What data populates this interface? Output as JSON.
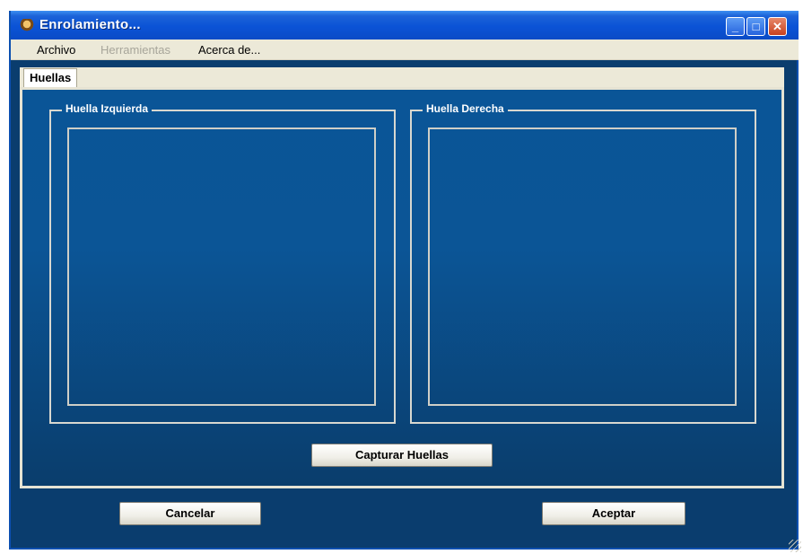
{
  "window": {
    "title": "Enrolamiento...",
    "icon": "app-icon",
    "controls": {
      "minimize": "_",
      "maximize": "□",
      "close": "✕"
    }
  },
  "menu": [
    {
      "label": "Archivo",
      "enabled": true
    },
    {
      "label": "Herramientas",
      "enabled": false
    },
    {
      "label": "Acerca de...",
      "enabled": true
    }
  ],
  "tabs": [
    {
      "label": "Huellas",
      "selected": true
    }
  ],
  "groups": {
    "left": {
      "label": "Huella Izquierda"
    },
    "right": {
      "label": "Huella Derecha"
    }
  },
  "buttons": {
    "capture": "Capturar Huellas",
    "cancel": "Cancelar",
    "accept": "Aceptar"
  },
  "colors": {
    "panel_top": "#0a5597",
    "panel_bottom": "#0a3d6c",
    "titlebar": "#0b53d6"
  }
}
